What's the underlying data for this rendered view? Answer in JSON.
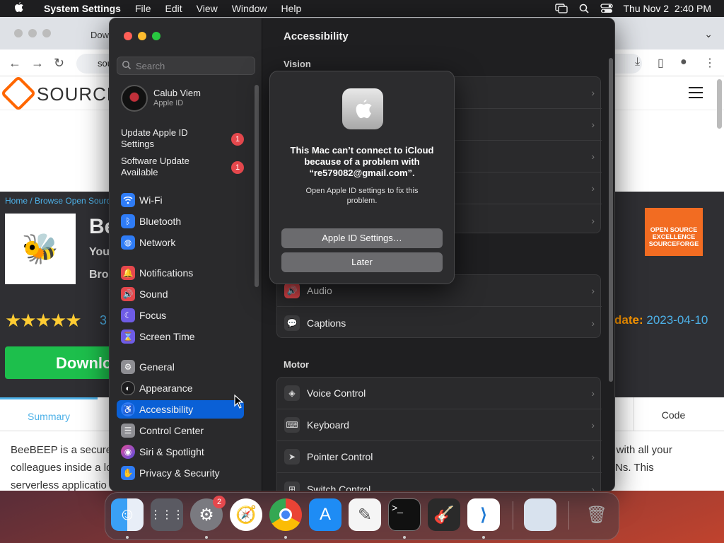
{
  "menubar": {
    "app_name": "System Settings",
    "menus": [
      "File",
      "Edit",
      "View",
      "Window",
      "Help"
    ],
    "clock": "Thu Nov 2  2:40 PM",
    "status_icons": [
      "screen-mirroring-icon",
      "spotlight-search-icon",
      "control-center-icon"
    ]
  },
  "browser": {
    "tab_title": "Dow",
    "url_prefix": "sou",
    "site_logo_text": "SOURCE",
    "breadcrumb": "Home / Browse Open Sourc",
    "project_title": "Be",
    "project_sub1": "You",
    "project_sub2": "Bro",
    "stars": "★★★★★",
    "rating_num": "3",
    "update_label": "date:",
    "update_date": "2023-04-10",
    "download_label": "Downlo",
    "badge_text": "OPEN SOURCE EXCELLENCE",
    "badge_sub": "SOURCEFORGE",
    "tab_summary": "Summary",
    "tab_code": "Code",
    "body_line1": "BeeBEEP is a secure",
    "body_line2": "colleagues inside a lo",
    "body_line3": "serverless applicatio",
    "body_right1": "s with all your",
    "body_right2": "PNs. This"
  },
  "settings": {
    "search_placeholder": "Search",
    "account": {
      "name": "Calub Viem",
      "sub": "Apple ID"
    },
    "notices": [
      {
        "label": "Update Apple ID Settings",
        "badge": "1"
      },
      {
        "label": "Software Update Available",
        "badge": "1"
      }
    ],
    "sidebar_items": [
      {
        "label": "Wi-Fi",
        "icon": "wifi-icon",
        "color": "#2f7cf6"
      },
      {
        "label": "Bluetooth",
        "icon": "bluetooth-icon",
        "color": "#2f7cf6"
      },
      {
        "label": "Network",
        "icon": "globe-icon",
        "color": "#2f7cf6"
      },
      {
        "label": "Notifications",
        "icon": "bell-icon",
        "color": "#e5484d"
      },
      {
        "label": "Sound",
        "icon": "speaker-icon",
        "color": "#e5484d"
      },
      {
        "label": "Focus",
        "icon": "moon-icon",
        "color": "#6e5ce6"
      },
      {
        "label": "Screen Time",
        "icon": "hourglass-icon",
        "color": "#6e5ce6"
      },
      {
        "label": "General",
        "icon": "gear-icon",
        "color": "#8e8e93"
      },
      {
        "label": "Appearance",
        "icon": "appearance-icon",
        "color": "#1c1c1e"
      },
      {
        "label": "Accessibility",
        "icon": "accessibility-icon",
        "color": "#2f7cf6"
      },
      {
        "label": "Control Center",
        "icon": "switches-icon",
        "color": "#8e8e93"
      },
      {
        "label": "Siri & Spotlight",
        "icon": "siri-icon",
        "color": "#b84ee0"
      },
      {
        "label": "Privacy & Security",
        "icon": "hand-icon",
        "color": "#2f7cf6"
      }
    ],
    "active_item": "Accessibility",
    "content_title": "Accessibility",
    "section_vision": "Vision",
    "section_motor": "Motor",
    "hearing_rows": [
      {
        "label": "Audio",
        "icon": "speaker-icon"
      },
      {
        "label": "Captions",
        "icon": "captions-icon"
      }
    ],
    "motor_rows": [
      {
        "label": "Voice Control",
        "icon": "voice-control-icon"
      },
      {
        "label": "Keyboard",
        "icon": "keyboard-icon"
      },
      {
        "label": "Pointer Control",
        "icon": "pointer-icon"
      },
      {
        "label": "Switch Control",
        "icon": "switch-control-icon"
      }
    ]
  },
  "modal": {
    "title": "This Mac can’t connect to iCloud because of a problem with “re579082@gmail.com”.",
    "text": "Open Apple ID settings to fix this problem.",
    "primary_button": "Apple ID Settings…",
    "secondary_button": "Later"
  },
  "dock": {
    "items": [
      "finder-icon",
      "launchpad-icon",
      "system-settings-icon",
      "safari-icon",
      "chrome-icon",
      "app-store-icon",
      "textedit-icon",
      "terminal-icon",
      "garageband-icon",
      "vscode-icon",
      "preview-icon",
      "trash-icon"
    ],
    "settings_badge": "2"
  }
}
